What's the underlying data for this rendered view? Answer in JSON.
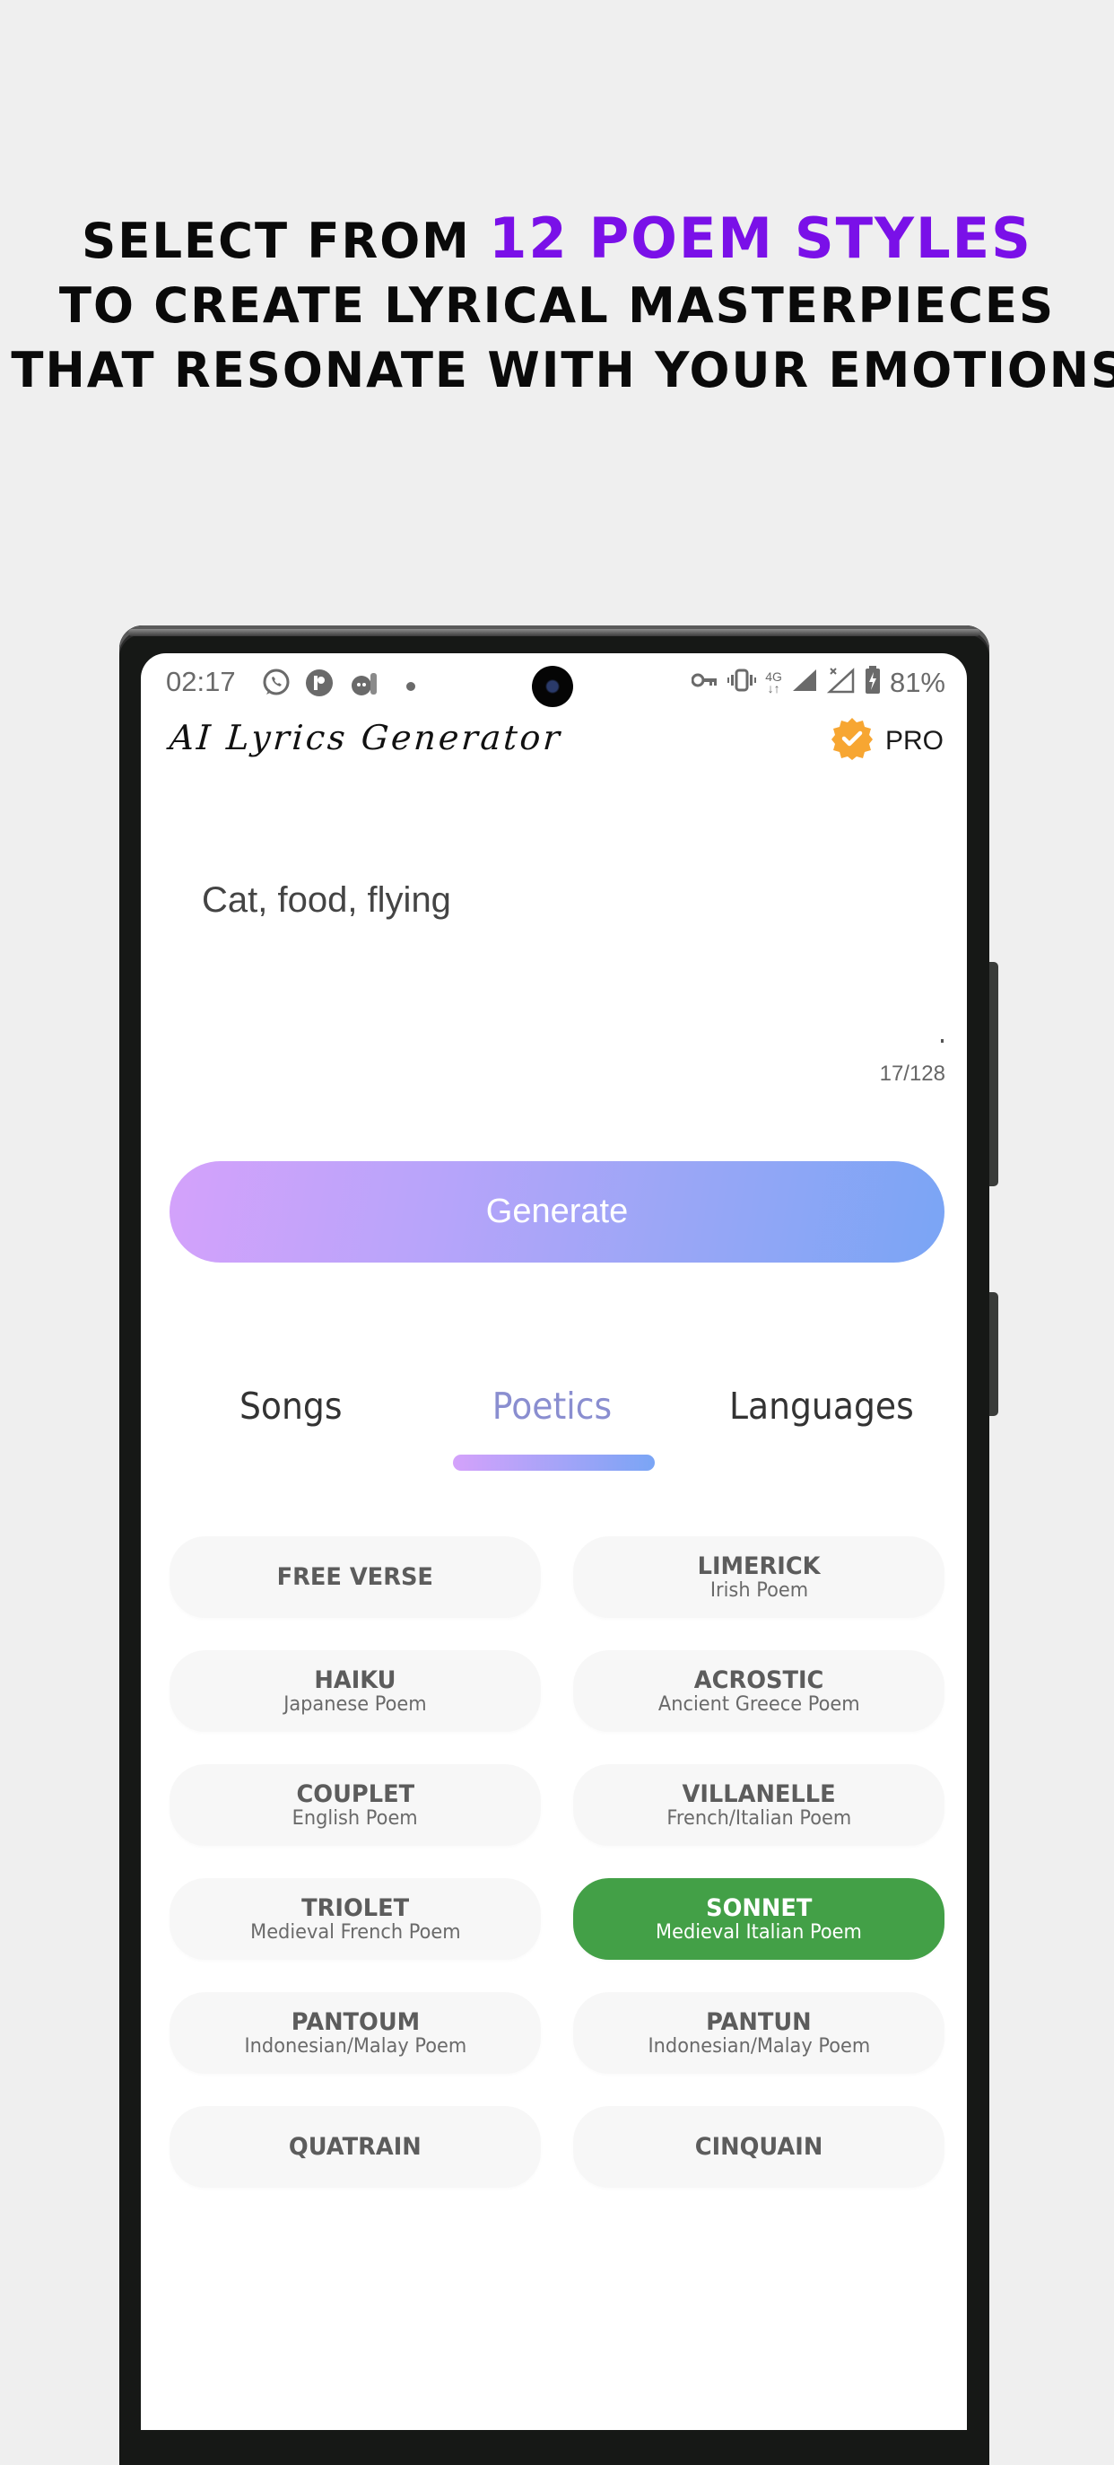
{
  "headline": {
    "line1_prefix": "SELECT FROM ",
    "line1_accent": "12 POEM STYLES",
    "line2": "TO CREATE LYRICAL MASTERPIECES",
    "line3": "THAT RESONATE WITH YOUR EMOTIONS",
    "accent_color": "#7a10e8"
  },
  "status_bar": {
    "time": "02:17",
    "left_icons": [
      "whatsapp-icon",
      "p-app-icon",
      "game-app-icon",
      "notification-dot-icon"
    ],
    "right_icons": [
      "vpn-key-icon",
      "vibrate-icon",
      "4g-data-icon",
      "signal-icon",
      "signal-no-service-icon",
      "battery-charging-icon"
    ],
    "network_label": "4G",
    "battery": "81%"
  },
  "app_bar": {
    "title": "AI Lyrics Generator",
    "pro_label": "PRO",
    "pro_badge_color": "#f7a632"
  },
  "prompt": {
    "value": "Cat, food, flying",
    "counter": "17/128"
  },
  "generate": {
    "label": "Generate"
  },
  "tabs": [
    {
      "label": "Songs",
      "active": false
    },
    {
      "label": "Poetics",
      "active": true
    },
    {
      "label": "Languages",
      "active": false
    }
  ],
  "poem_styles": [
    {
      "name": "FREE VERSE",
      "subtitle": "",
      "selected": false
    },
    {
      "name": "LIMERICK",
      "subtitle": "Irish Poem",
      "selected": false
    },
    {
      "name": "HAIKU",
      "subtitle": "Japanese Poem",
      "selected": false
    },
    {
      "name": "ACROSTIC",
      "subtitle": "Ancient Greece Poem",
      "selected": false
    },
    {
      "name": "COUPLET",
      "subtitle": "English Poem",
      "selected": false
    },
    {
      "name": "VILLANELLE",
      "subtitle": "French/Italian Poem",
      "selected": false
    },
    {
      "name": "TRIOLET",
      "subtitle": "Medieval French Poem",
      "selected": false
    },
    {
      "name": "SONNET",
      "subtitle": "Medieval Italian Poem",
      "selected": true
    },
    {
      "name": "PANTOUM",
      "subtitle": "Indonesian/Malay Poem",
      "selected": false
    },
    {
      "name": "PANTUN",
      "subtitle": "Indonesian/Malay Poem",
      "selected": false
    },
    {
      "name": "QUATRAIN",
      "subtitle": "",
      "selected": false
    },
    {
      "name": "CINQUAIN",
      "subtitle": "",
      "selected": false
    }
  ],
  "colors": {
    "selected": "#43a047",
    "active_tab": "#8a8ed0",
    "gradient_start": "#d4a2fb",
    "gradient_end": "#7aa5f5"
  }
}
